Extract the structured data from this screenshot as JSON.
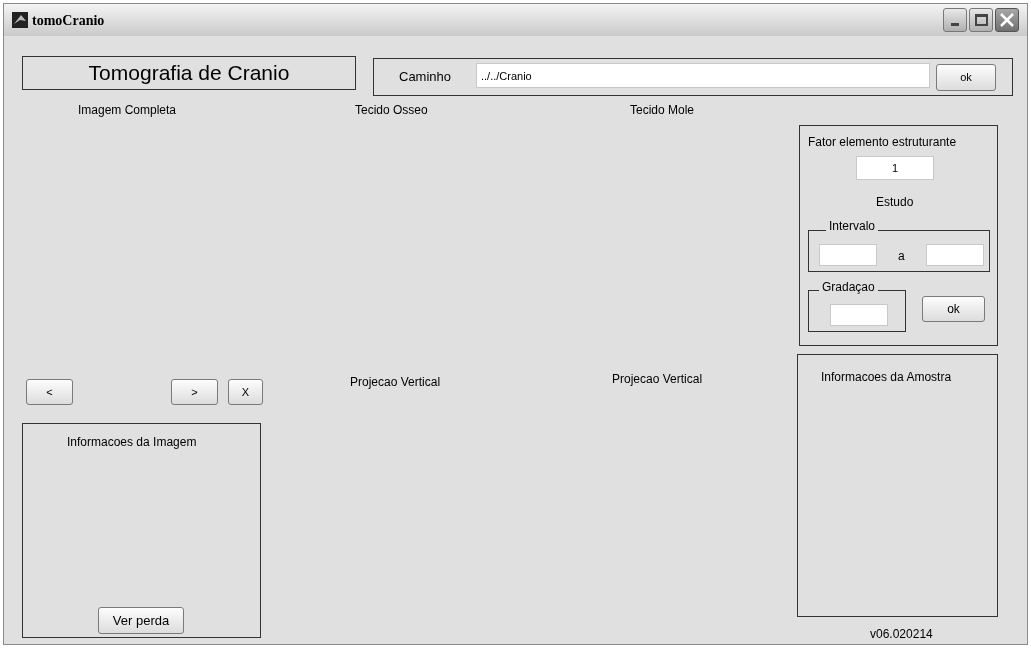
{
  "window": {
    "title": "tomoCranio"
  },
  "header": {
    "title": "Tomografia de Cranio"
  },
  "path": {
    "label": "Caminho",
    "value": "../../Cranio",
    "button": "ok"
  },
  "axes_labels": [
    {
      "text": "Imagem Completa"
    },
    {
      "text": "Tecido Osseo"
    },
    {
      "text": "Tecido Mole"
    }
  ],
  "structuring_panel": {
    "title": "Fator elemento estruturante",
    "factor": "1",
    "study_label": "Estudo",
    "interval": {
      "title": "Intervalo",
      "separator": "a"
    },
    "gradation": {
      "title": "Gradaçao"
    },
    "button": "ok"
  },
  "nav_buttons": [
    "<",
    ">",
    "X"
  ],
  "projection_labels": [
    "Projecao Vertical",
    "Projecao Vertical"
  ],
  "image_info": {
    "title": "Informacoes da Imagem",
    "button": "Ver perda"
  },
  "sample_info": {
    "title": "Informacoes da Amostra"
  },
  "version": "v06.020214"
}
